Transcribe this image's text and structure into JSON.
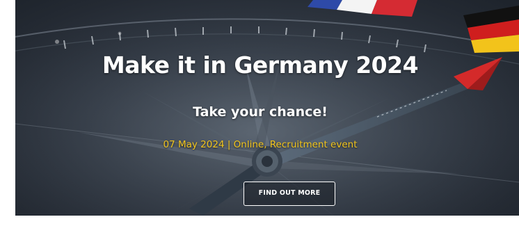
{
  "hero": {
    "title": "Make it in Germany 2024",
    "subtitle": "Take your chance!",
    "event_details": "07 May 2024 | Online, Recruitment event",
    "cta_label": "FIND OUT MORE"
  },
  "colors": {
    "event_text": "#f2c51d",
    "needle_red": "#d42a2a",
    "background": "#2c333d"
  },
  "icons": {
    "flag_germany": "germany-flag-icon",
    "flag_france": "france-flag-icon"
  }
}
